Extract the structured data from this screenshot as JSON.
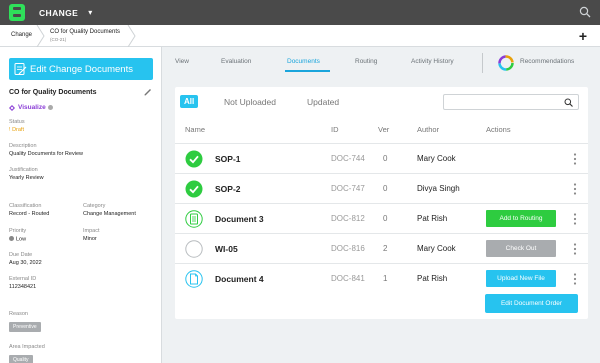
{
  "topbar": {
    "app_name": "CHANGE",
    "chevron": "▾"
  },
  "breadcrumb": {
    "items": [
      "Change",
      "CO for Quality Documents"
    ],
    "sub": "(CO-21)",
    "plus": "+"
  },
  "left_panel": {
    "edit_button": "Edit Change Documents",
    "doc_title": "CO for Quality Documents",
    "visualize": "Visualize",
    "status_label": "Status",
    "status_value": "Draft",
    "description_label": "Description",
    "description_value": "Quality Documents for Review",
    "justification_label": "Justification",
    "justification_value": "Yearly Review",
    "classification_label": "Classification",
    "classification_value": "Record - Routed",
    "category_label": "Category",
    "category_value": "Change Management",
    "priority_label": "Priority",
    "priority_value": "Low",
    "impact_label": "Impact",
    "impact_value": "Minor",
    "due_date_label": "Due Date",
    "due_date_value": "Aug 30, 2022",
    "external_id_label": "External ID",
    "external_id_value": "112348421",
    "reason_label": "Reason",
    "reason_tag": "Preventive",
    "area_label": "Area Impacted",
    "area_tag": "Quality"
  },
  "tabs": {
    "items": [
      "View",
      "Evaluation",
      "Documents",
      "Routing",
      "Activity History"
    ],
    "active": "Documents",
    "recommendations": "Recommendations"
  },
  "filters": {
    "all": "All",
    "not_uploaded": "Not Uploaded",
    "updated": "Updated"
  },
  "table": {
    "headers": {
      "name": "Name",
      "id": "ID",
      "ver": "Ver",
      "author": "Author",
      "actions": "Actions"
    },
    "rows": [
      {
        "status": "check",
        "name": "SOP-1",
        "id": "DOC-744",
        "ver": "0",
        "author": "Mary Cook",
        "action": ""
      },
      {
        "status": "check",
        "name": "SOP-2",
        "id": "DOC-747",
        "ver": "0",
        "author": "Divya Singh",
        "action": ""
      },
      {
        "status": "document",
        "name": "Document 3",
        "id": "DOC-812",
        "ver": "0",
        "author": "Pat Rish",
        "action": "Add to Routing"
      },
      {
        "status": "empty",
        "name": "WI-05",
        "id": "DOC-816",
        "ver": "2",
        "author": "Mary Cook",
        "action": "Check Out"
      },
      {
        "status": "blank-doc",
        "name": "Document 4",
        "id": "DOC-841",
        "ver": "1",
        "author": "Pat Rish",
        "action": "Upload New File"
      }
    ]
  },
  "edit_order_button": "Edit Document Order",
  "colors": {
    "accent": "#27c3ef",
    "success": "#2ecc40",
    "neutral": "#a9acaf",
    "draft": "#e8a10c",
    "visualize": "#8a3dd6"
  },
  "icons": [
    "logo-icon",
    "chevron-down-icon",
    "search-icon",
    "plus-icon",
    "edit-document-icon",
    "pencil-icon",
    "visualize-icon",
    "info-icon",
    "recommendations-icon",
    "check-circle-icon",
    "document-circle-icon",
    "empty-circle-icon",
    "blank-document-circle-icon",
    "kebab-icon"
  ]
}
